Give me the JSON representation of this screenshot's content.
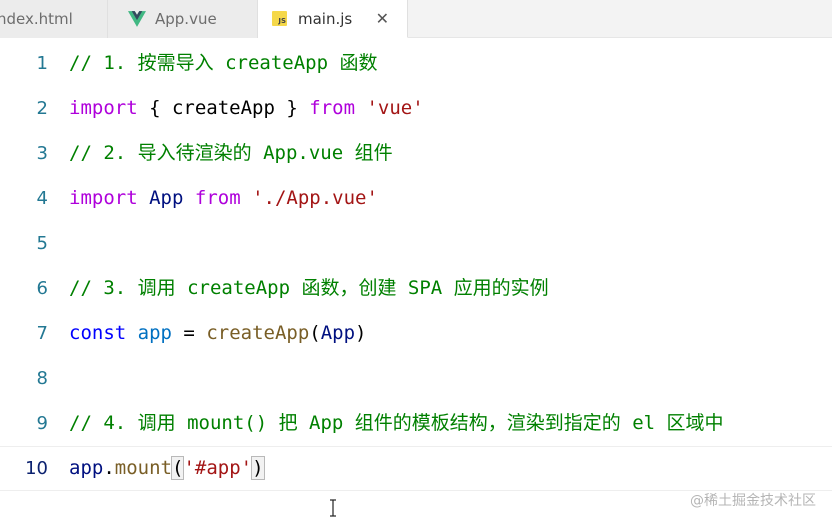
{
  "tabs": [
    {
      "label": "ndex.html"
    },
    {
      "label": "App.vue",
      "icon": "vue-icon"
    },
    {
      "label": "main.js",
      "icon": "js-icon",
      "badge": "JS",
      "close": "✕"
    }
  ],
  "colors": {
    "comment": "#008000",
    "keyword": "#af00db",
    "string": "#a31515",
    "function": "#795e26",
    "variable": "#001080",
    "line_number": "#237893",
    "vue_green": "#41b883",
    "js_yellow": "#f5d84a"
  },
  "editor": {
    "current_line": 10,
    "lines": [
      {
        "num": "1",
        "tokens": [
          "// 1. 按需导入 createApp 函数"
        ]
      },
      {
        "num": "2",
        "tokens": [
          "import",
          " { ",
          "createApp",
          " } ",
          "from",
          " ",
          "'vue'"
        ]
      },
      {
        "num": "3",
        "tokens": [
          "// 2. 导入待渲染的 App.vue 组件"
        ]
      },
      {
        "num": "4",
        "tokens": [
          "import",
          " ",
          "App",
          " ",
          "from",
          " ",
          "'./App.vue'"
        ]
      },
      {
        "num": "5",
        "tokens": [
          ""
        ]
      },
      {
        "num": "6",
        "tokens": [
          "// 3. 调用 createApp 函数，创建 SPA 应用的实例"
        ]
      },
      {
        "num": "7",
        "tokens": [
          "const",
          " ",
          "app",
          " = ",
          "createApp",
          "(",
          "App",
          ")"
        ]
      },
      {
        "num": "8",
        "tokens": [
          ""
        ]
      },
      {
        "num": "9",
        "tokens": [
          "// 4. 调用 mount() 把 App 组件的模板结构，渲染到指定的 el 区域中"
        ]
      },
      {
        "num": "10",
        "tokens": [
          "app",
          ".",
          "mount",
          "(",
          "'#app'",
          ")"
        ]
      }
    ]
  },
  "watermark": "@稀土掘金技术社区"
}
